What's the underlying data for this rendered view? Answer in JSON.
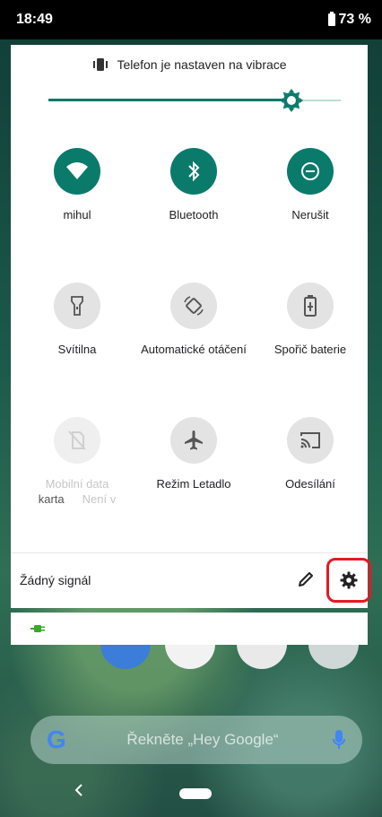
{
  "status_bar": {
    "time": "18:49",
    "battery": "73 %"
  },
  "quick_settings": {
    "vibrate_text": "Telefon je nastaven na vibrace",
    "brightness_level": 0.83,
    "tiles": [
      {
        "label": "mihul",
        "icon": "wifi-icon",
        "state": "active"
      },
      {
        "label": "Bluetooth",
        "icon": "bluetooth-icon",
        "state": "active"
      },
      {
        "label": "Nerušit",
        "icon": "do-not-disturb-icon",
        "state": "active"
      },
      {
        "label": "Svítilna",
        "icon": "flashlight-icon",
        "state": "inactive"
      },
      {
        "label": "Automatické otáčení",
        "icon": "auto-rotate-icon",
        "state": "inactive"
      },
      {
        "label": "Spořič baterie",
        "icon": "battery-saver-icon",
        "state": "inactive"
      },
      {
        "label": "Mobilní data",
        "sublabel_left": "karta",
        "sublabel_right": "Není v",
        "icon": "mobile-data-off-icon",
        "state": "disabled"
      },
      {
        "label": "Režim Letadlo",
        "icon": "airplane-icon",
        "state": "inactive"
      },
      {
        "label": "Odesílání",
        "icon": "cast-icon",
        "state": "inactive"
      }
    ],
    "footer": {
      "signal_text": "Žádný signál"
    }
  },
  "home": {
    "search_hint": "Řekněte „Hey Google“"
  },
  "colors": {
    "accent": "#0a7a6b",
    "highlight": "#e11b22"
  }
}
